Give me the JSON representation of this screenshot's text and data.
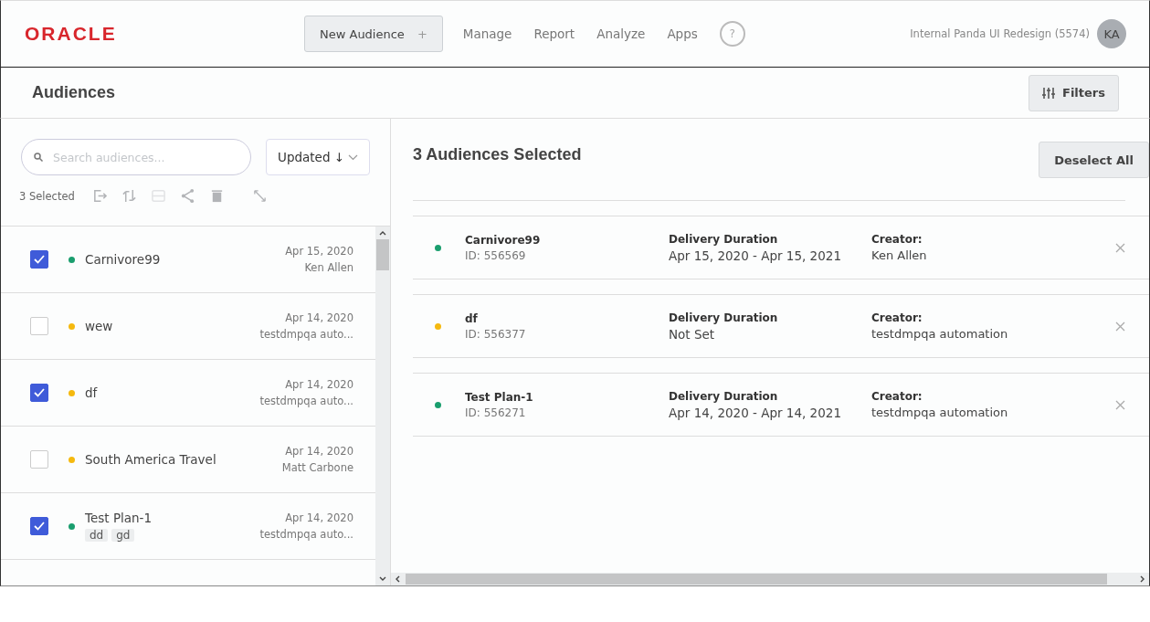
{
  "header": {
    "logo": "ORACLE",
    "new_button": "New Audience",
    "new_button_icon": "+",
    "nav": [
      "Manage",
      "Report",
      "Analyze",
      "Apps"
    ],
    "help": "?",
    "account": "Internal Panda UI Redesign (5574)",
    "avatar": "KA"
  },
  "page": {
    "title": "Audiences",
    "filters_button": "Filters"
  },
  "left": {
    "search": {
      "placeholder": "Search audiences..."
    },
    "sort": "Updated ↓",
    "selected_count": "3 Selected",
    "toolbar": [
      {
        "kind": "export",
        "disabled": false
      },
      {
        "kind": "sync",
        "disabled": false
      },
      {
        "kind": "card",
        "disabled": true
      },
      {
        "kind": "share",
        "disabled": false
      },
      {
        "kind": "delete",
        "disabled": false
      },
      {
        "kind": "expand",
        "disabled": false
      }
    ],
    "items": [
      {
        "name": "Carnivore99",
        "checked": true,
        "color": "#1a9e6e",
        "date": "Apr 15, 2020",
        "owner": "Ken Allen"
      },
      {
        "name": "wew",
        "checked": false,
        "color": "#f5b90f",
        "date": "Apr 14, 2020",
        "owner": "testdmpqa auto..."
      },
      {
        "name": "df",
        "checked": true,
        "color": "#f5b90f",
        "date": "Apr 14, 2020",
        "owner": "testdmpqa auto..."
      },
      {
        "name": "South America Travel",
        "checked": false,
        "color": "#f5b90f",
        "date": "Apr 14, 2020",
        "owner": "Matt Carbone"
      },
      {
        "name": "Test Plan-1",
        "checked": true,
        "color": "#1a9e6e",
        "date": "Apr 14, 2020",
        "owner": "testdmpqa auto...",
        "tags": [
          "dd",
          "gd"
        ]
      }
    ]
  },
  "right": {
    "title": "3 Audiences Selected",
    "deselect_button": "Deselect All",
    "cards": [
      {
        "name": "Carnivore99",
        "id": "ID: 556569",
        "color": "#1a9e6e",
        "duration_label": "Delivery Duration",
        "duration": "Apr 15, 2020 - Apr 15, 2021",
        "creator_label": "Creator:",
        "creator": "Ken Allen"
      },
      {
        "name": "df",
        "id": "ID: 556377",
        "color": "#f5b90f",
        "duration_label": "Delivery Duration",
        "duration": "Not Set",
        "creator_label": "Creator:",
        "creator": "testdmpqa automation"
      },
      {
        "name": "Test Plan-1",
        "id": "ID: 556271",
        "color": "#1a9e6e",
        "duration_label": "Delivery Duration",
        "duration": "Apr 14, 2020 - Apr 14, 2021",
        "creator_label": "Creator:",
        "creator": "testdmpqa automation"
      }
    ]
  }
}
